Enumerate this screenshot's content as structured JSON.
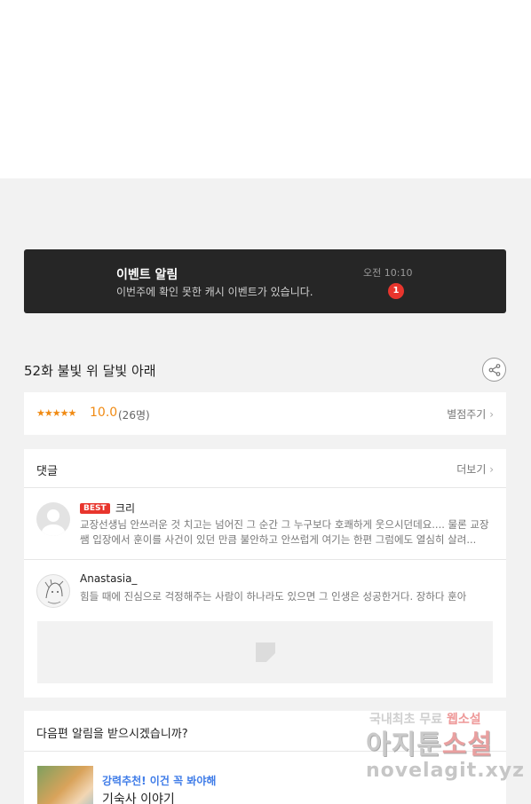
{
  "banner": {
    "title": "이벤트 알림",
    "message": "이번주에 확인 못한 캐시 이벤트가 있습니다.",
    "time": "오전 10:10",
    "badge": "1"
  },
  "episode": {
    "title": "52화 불빛 위 달빛 아래",
    "share_icon": "share-icon"
  },
  "rating": {
    "stars": "★★★★★",
    "score": "10.0",
    "count": "(26명)",
    "rate_link": "별점주기"
  },
  "comments": {
    "title": "댓글",
    "more": "더보기",
    "items": [
      {
        "badge": "BEST",
        "name": "크리",
        "text": "교장선생님 안쓰러운 것 치고는 넘어진 그 순간 그 누구보다 호쾌하게 웃으시던데요.... 물론 교장쌤 입장에서 훈이를 사건이 있던 만큼 불안하고 안쓰럽게 여기는 한편 그럼에도 열심히 살려..."
      },
      {
        "name": "Anastasia_",
        "text": "힘들 때에 진심으로 걱정해주는 사람이 하나라도 있으면 그 인생은 성공한거다. 장하다 훈아"
      }
    ]
  },
  "notice": {
    "question": "다음편 알림을 받으시겠습니까?",
    "rec_tag": "강력추천! 이건 꼭 봐야해",
    "rec_title": "기숙사 이야기"
  },
  "watermark": {
    "line1_a": "국내최초 무료 ",
    "line1_b": "웹소설",
    "line2_a": "아지툰",
    "line2_b": "소설",
    "line3": "novelagit.xyz"
  }
}
